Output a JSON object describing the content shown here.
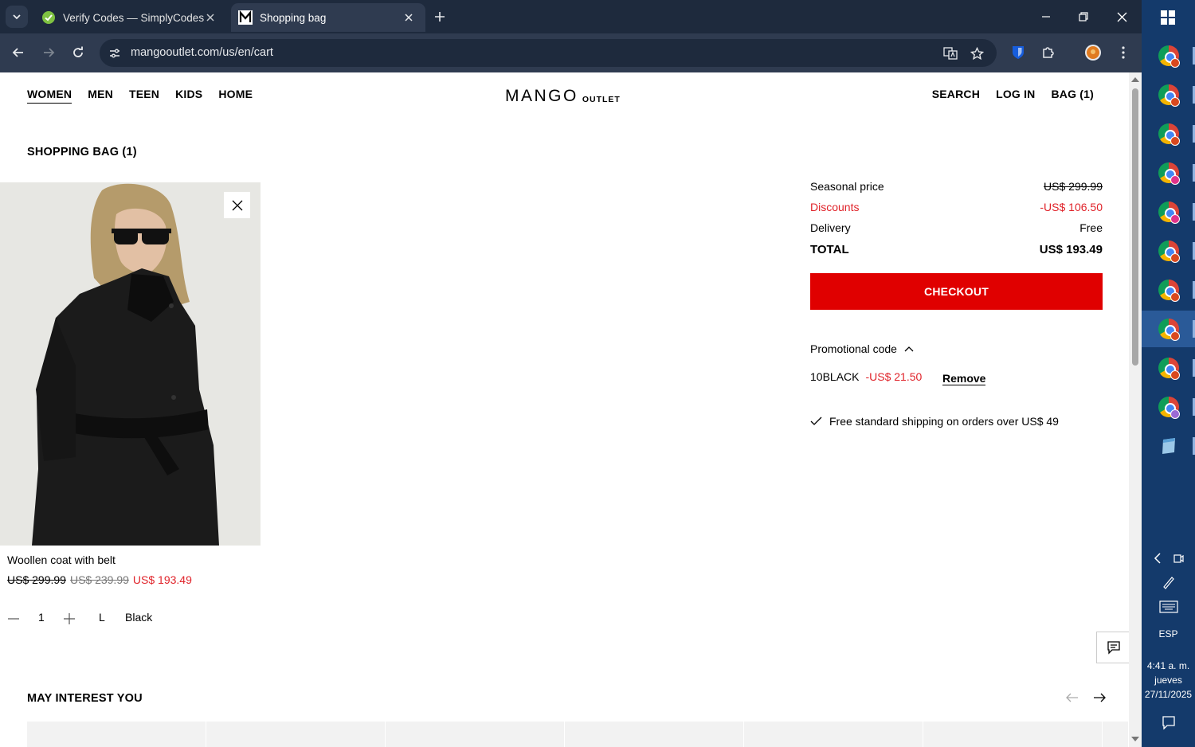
{
  "browser": {
    "tabs": [
      {
        "title": "Verify Codes — SimplyCodes",
        "active": false
      },
      {
        "title": "Shopping bag",
        "active": true
      }
    ],
    "url": "mangooutlet.com/us/en/cart"
  },
  "header": {
    "nav_left": [
      "WOMEN",
      "MEN",
      "TEEN",
      "KIDS",
      "HOME"
    ],
    "logo_main": "MANGO",
    "logo_sub": "OUTLET",
    "nav_right": [
      "SEARCH",
      "LOG IN",
      "BAG (1)"
    ]
  },
  "bag": {
    "title": "SHOPPING BAG (1)",
    "item": {
      "name": "Woollen coat with belt",
      "price_original": "US$ 299.99",
      "price_outlet": "US$ 239.99",
      "price_final": "US$ 193.49",
      "quantity": "1",
      "size": "L",
      "color": "Black"
    }
  },
  "summary": {
    "seasonal_label": "Seasonal price",
    "seasonal_value": "US$ 299.99",
    "discounts_label": "Discounts",
    "discounts_value": "-US$ 106.50",
    "delivery_label": "Delivery",
    "delivery_value": "Free",
    "total_label": "TOTAL",
    "total_value": "US$ 193.49",
    "checkout_label": "CHECKOUT",
    "promo_label": "Promotional code",
    "promo_code": "10BLACK",
    "promo_amount": "-US$ 21.50",
    "promo_remove": "Remove",
    "shipping_note": "Free standard shipping on orders over US$ 49"
  },
  "recommendations": {
    "title": "MAY INTEREST YOU"
  },
  "taskbar": {
    "language": "ESP",
    "time": "4:41 a. m.",
    "day": "jueves",
    "date": "27/11/2025"
  },
  "colors": {
    "accent_red": "#e00000",
    "discount_red": "#e0232a",
    "browser_dark": "#1e2a3d",
    "taskbar_blue": "#143a6b"
  }
}
